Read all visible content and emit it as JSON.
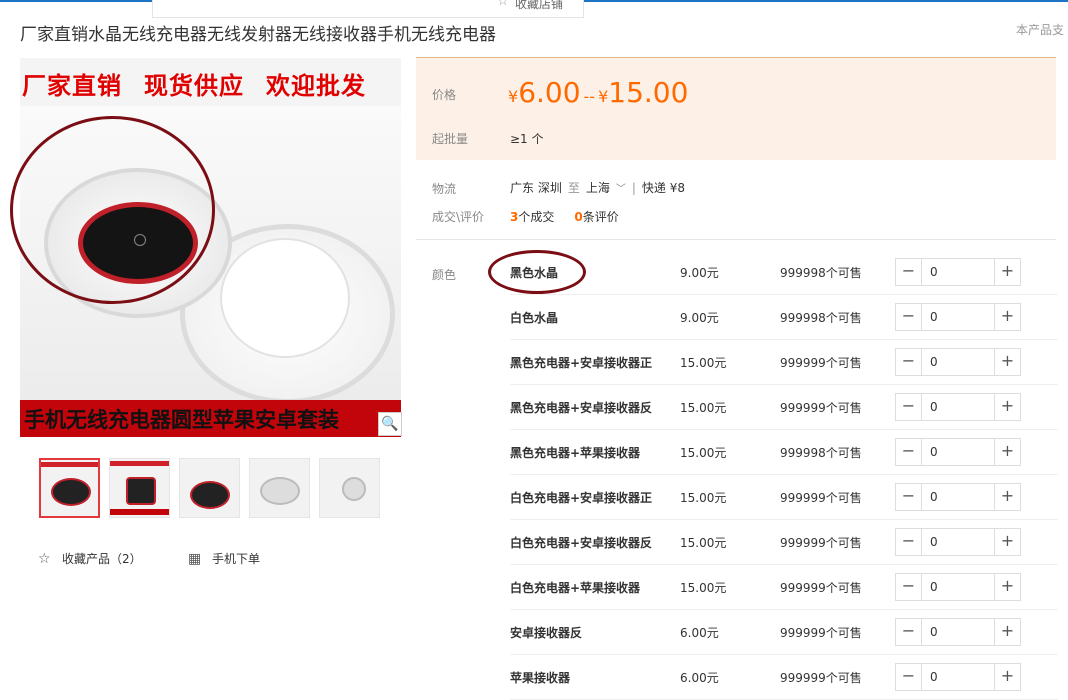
{
  "favorite_popup": {
    "label": "收藏店铺"
  },
  "title": "厂家直销水晶无线充电器无线发射器无线接收器手机无线充电器",
  "support_text": "本产品支",
  "gallery": {
    "banner_top": [
      "厂家直销",
      "现货供应",
      "欢迎批发"
    ],
    "banner_bottom": "手机无线充电器圆型苹果安卓套装",
    "thumbnails": [
      {
        "active": true,
        "dark": true
      },
      {
        "active": false,
        "dark": true
      },
      {
        "active": false,
        "dark": false
      },
      {
        "active": false,
        "dark": false
      },
      {
        "active": false,
        "dark": false
      }
    ]
  },
  "actions": {
    "favorite": "收藏产品（2）",
    "mobile_order": "手机下单"
  },
  "price": {
    "label": "价格",
    "currency": "¥",
    "low": "6.00",
    "high": "15.00",
    "dash": "--",
    "moq_label": "起批量",
    "moq_value": "≥1 个"
  },
  "logistics": {
    "label": "物流",
    "origin": "广东 深圳",
    "to": "至",
    "destination": "上海",
    "express": "快递 ¥8",
    "deal_label": "成交\\评价",
    "deals": "3",
    "deals_text": "个成交",
    "reviews": "0",
    "reviews_text": "条评价"
  },
  "sku": {
    "label": "颜色",
    "items": [
      {
        "name": "黑色水晶",
        "price": "9.00元",
        "stock": "999998个可售",
        "qty": "0"
      },
      {
        "name": "白色水晶",
        "price": "9.00元",
        "stock": "999998个可售",
        "qty": "0"
      },
      {
        "name": "黑色充电器+安卓接收器正",
        "price": "15.00元",
        "stock": "999999个可售",
        "qty": "0"
      },
      {
        "name": "黑色充电器+安卓接收器反",
        "price": "15.00元",
        "stock": "999999个可售",
        "qty": "0"
      },
      {
        "name": "黑色充电器+苹果接收器",
        "price": "15.00元",
        "stock": "999998个可售",
        "qty": "0"
      },
      {
        "name": "白色充电器+安卓接收器正",
        "price": "15.00元",
        "stock": "999999个可售",
        "qty": "0"
      },
      {
        "name": "白色充电器+安卓接收器反",
        "price": "15.00元",
        "stock": "999999个可售",
        "qty": "0"
      },
      {
        "name": "白色充电器+苹果接收器",
        "price": "15.00元",
        "stock": "999999个可售",
        "qty": "0"
      },
      {
        "name": "安卓接收器反",
        "price": "6.00元",
        "stock": "999999个可售",
        "qty": "0"
      },
      {
        "name": "苹果接收器",
        "price": "6.00元",
        "stock": "999999个可售",
        "qty": "0"
      }
    ]
  },
  "colors": {
    "accent": "#ff6a00",
    "price_bg": "#fdf1e7",
    "banner_red": "#e00000",
    "annotation": "#7a0e14"
  }
}
